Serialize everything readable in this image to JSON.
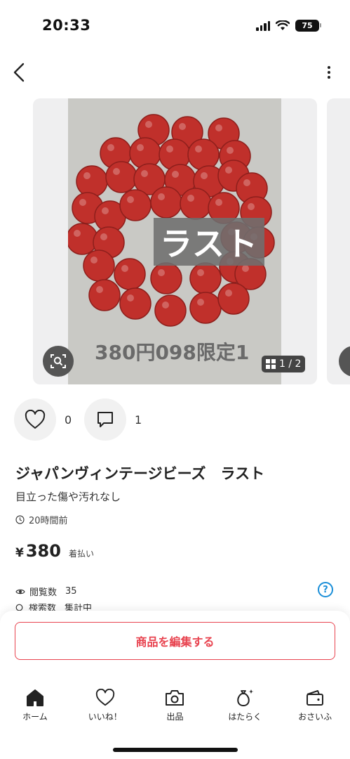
{
  "status": {
    "time": "20:33",
    "battery": "75"
  },
  "nav": {
    "back_icon": "chevron-left-icon",
    "more_icon": "vertical-dots-icon"
  },
  "gallery": {
    "overlay_text": "ラスト",
    "price_caption": "380円098限定1",
    "page_counter": "1 / 2",
    "bead_color": "#c0302b"
  },
  "actions": {
    "likes": "0",
    "comments": "1"
  },
  "product": {
    "title": "ジャパンヴィンテージビーズ　ラスト",
    "condition": "目立った傷や汚れなし",
    "posted": "20時間前",
    "currency": "¥",
    "price": "380",
    "shipping": "着払い"
  },
  "stats": {
    "views_label": "閲覧数",
    "views": "35",
    "search_label": "検索数",
    "search_value": "集計中"
  },
  "edit_button": "商品を編集する",
  "tabs": [
    {
      "label": "ホーム",
      "icon": "home-icon"
    },
    {
      "label": "いいね！",
      "icon": "heart-icon"
    },
    {
      "label": "出品",
      "icon": "camera-icon"
    },
    {
      "label": "はたらく",
      "icon": "money-bag-icon"
    },
    {
      "label": "おさいふ",
      "icon": "wallet-icon"
    }
  ],
  "colors": {
    "accent": "#e8434f",
    "help_blue": "#1a8ed8"
  }
}
